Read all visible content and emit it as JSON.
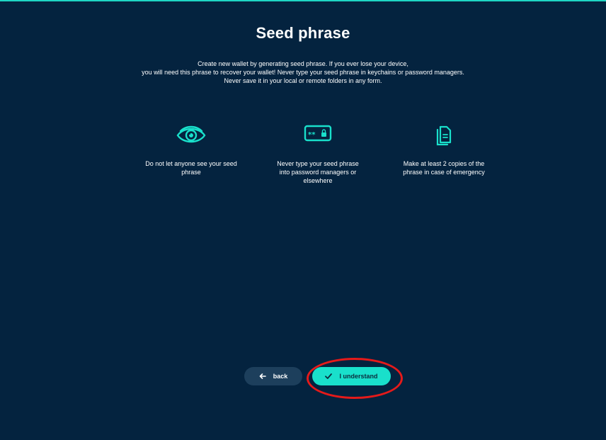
{
  "header": {
    "title": "Seed phrase"
  },
  "description": {
    "line1": "Create new wallet by generating seed phrase. If you ever lose your device,",
    "line2": "you will need this phrase to recover your wallet! Never type your seed phrase in keychains or password managers.",
    "line3": "Never save it in your local or remote folders in any form."
  },
  "tips": [
    {
      "icon": "eye-icon",
      "line1": "Do not let anyone see your seed",
      "line2": "phrase",
      "line3": ""
    },
    {
      "icon": "password-field-icon",
      "line1": "Never type your seed phrase",
      "line2": "into password managers or",
      "line3": "elsewhere"
    },
    {
      "icon": "copies-document-icon",
      "line1": "Make at least 2 copies of the",
      "line2": "phrase in case of emergency",
      "line3": ""
    }
  ],
  "buttons": {
    "back_label": "back",
    "back_icon": "arrow-left-icon",
    "understand_label": "I understand",
    "understand_icon": "checkmark-icon"
  },
  "colors": {
    "background": "#04233f",
    "accent": "#19e0cb",
    "secondary_button": "#1d3f5c",
    "highlight": "#e51a1a"
  }
}
